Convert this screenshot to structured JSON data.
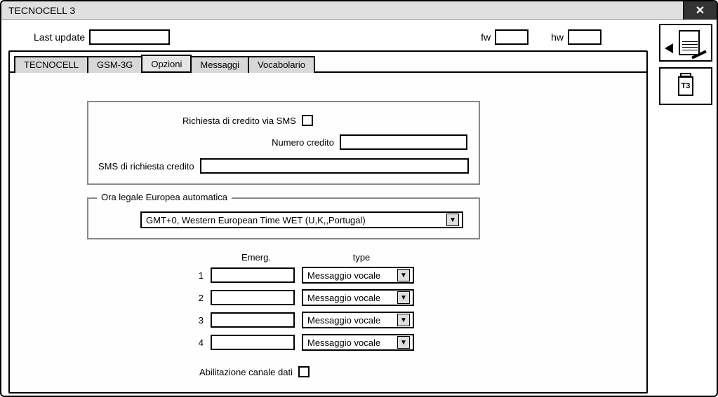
{
  "window": {
    "title": "TECNOCELL 3"
  },
  "header": {
    "last_update_label": "Last update",
    "last_update_value": "",
    "fw_label": "fw",
    "fw_value": "",
    "hw_label": "hw",
    "hw_value": ""
  },
  "tabs": {
    "items": [
      {
        "label": "TECNOCELL"
      },
      {
        "label": "GSM-3G"
      },
      {
        "label": "Opzioni"
      },
      {
        "label": "Messaggi"
      },
      {
        "label": "Vocabolario"
      }
    ],
    "active_index": 2
  },
  "credit": {
    "request_via_sms_label": "Richiesta di credito via SMS",
    "request_via_sms_checked": false,
    "numero_credito_label": "Numero credito",
    "numero_credito_value": "",
    "sms_richiesta_label": "SMS di richiesta credito",
    "sms_richiesta_value": ""
  },
  "dst": {
    "group_label": "Ora legale Europea automatica",
    "selected": "GMT+0, Western European Time WET (U,K,,Portugal)"
  },
  "emerg": {
    "col_emerg": "Emerg.",
    "col_type": "type",
    "rows": [
      {
        "num": "1",
        "value": "",
        "type": "Messaggio vocale"
      },
      {
        "num": "2",
        "value": "",
        "type": "Messaggio vocale"
      },
      {
        "num": "3",
        "value": "",
        "type": "Messaggio vocale"
      },
      {
        "num": "4",
        "value": "",
        "type": "Messaggio vocale"
      }
    ]
  },
  "data_channel": {
    "label": "Abilitazione canale dati",
    "checked": false
  },
  "side": {
    "icon_t3": "T3"
  }
}
